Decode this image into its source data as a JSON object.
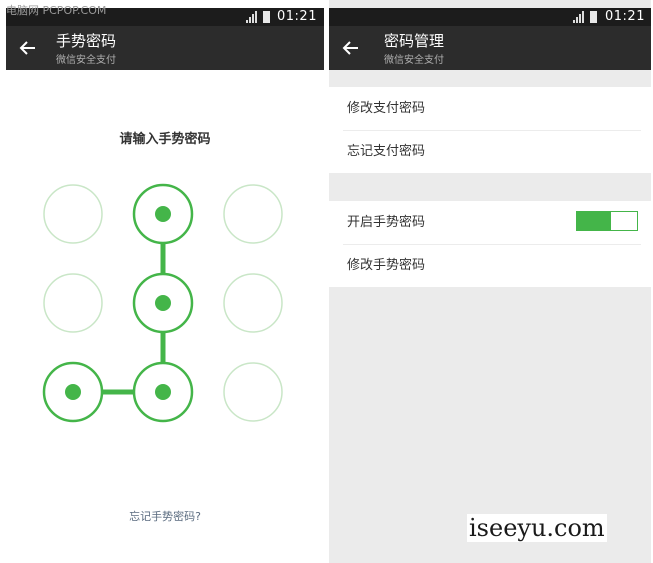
{
  "left_screen": {
    "status_bar": {
      "time": "01:21",
      "watermark_text": "电脑网 PCPOP.COM"
    },
    "app_bar": {
      "title": "手势密码",
      "subtitle": "微信安全支付"
    },
    "prompt": "请输入手势密码",
    "pattern": {
      "grid_size": 3,
      "selected_dots": [
        1,
        4,
        7,
        6
      ],
      "accent_color": "#44b549",
      "inactive_ring_color": "#c9e6c7"
    },
    "forgot_link": "忘记手势密码?"
  },
  "right_screen": {
    "status_bar": {
      "time": "01:21"
    },
    "app_bar": {
      "title": "密码管理",
      "subtitle": "微信安全支付"
    },
    "payment_section": {
      "items": [
        {
          "label": "修改支付密码"
        },
        {
          "label": "忘记支付密码"
        }
      ]
    },
    "gesture_section": {
      "toggle": {
        "label": "开启手势密码",
        "enabled": true
      },
      "items": [
        {
          "label": "修改手势密码"
        }
      ]
    }
  },
  "watermark": "iseeyu.com"
}
